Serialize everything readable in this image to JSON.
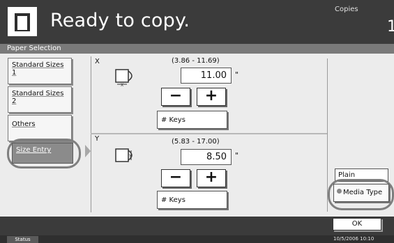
{
  "header": {
    "message": "Ready to copy.",
    "copies_label": "Copies",
    "copies_value": "1"
  },
  "section": {
    "title": "Paper Selection"
  },
  "size_buttons": [
    {
      "label": "Standard Sizes 1"
    },
    {
      "label": "Standard Sizes 2"
    },
    {
      "label": "Others"
    },
    {
      "label": "Size Entry",
      "selected": true
    }
  ],
  "x_entry": {
    "axis": "X",
    "range": "(3.86 - 11.69)",
    "value": "11.00",
    "unit": "\"",
    "minus": "−",
    "plus": "+",
    "keys_label": "# Keys",
    "icon": "paper-width-icon"
  },
  "y_entry": {
    "axis": "Y",
    "range": "(5.83 - 17.00)",
    "value": "8.50",
    "unit": "\"",
    "minus": "−",
    "plus": "+",
    "keys_label": "# Keys",
    "icon": "paper-length-icon"
  },
  "media": {
    "current": "Plain",
    "button_label": "Media Type"
  },
  "footer": {
    "ok_label": "OK",
    "status_label": "Status",
    "datetime": "10/5/2006   10:10"
  },
  "colors": {
    "header_bg": "#3b3b3b",
    "panel_bg": "#ececec",
    "selected_bg": "#8b8b8b",
    "highlight_ring": "#7f7f7f"
  }
}
